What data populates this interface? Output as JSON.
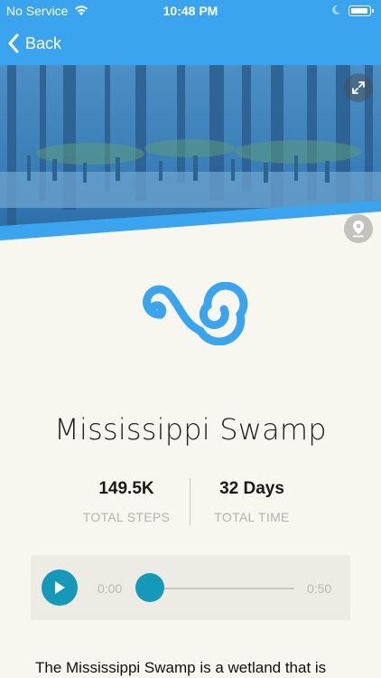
{
  "status_bar": {
    "carrier": "No Service",
    "time": "10:48 PM",
    "battery_level": 0.95
  },
  "nav": {
    "back_label": "Back"
  },
  "hero": {
    "image_subject": "swamp forest with cypress knees, blue tint",
    "expand_icon": "expand-icon",
    "location_icon": "map-pin-icon"
  },
  "logo": {
    "icon": "swirl-logo-icon",
    "color": "#3aa4ee"
  },
  "title": "Mississippi Swamp",
  "stats": {
    "steps_value": "149.5K",
    "steps_label": "TOTAL STEPS",
    "time_value": "32 Days",
    "time_label": "TOTAL TIME"
  },
  "audio": {
    "current_time": "0:00",
    "total_time": "0:50",
    "progress": 0,
    "accent_color": "#1698b8"
  },
  "description": "The Mississippi Swamp is a wetland that is"
}
